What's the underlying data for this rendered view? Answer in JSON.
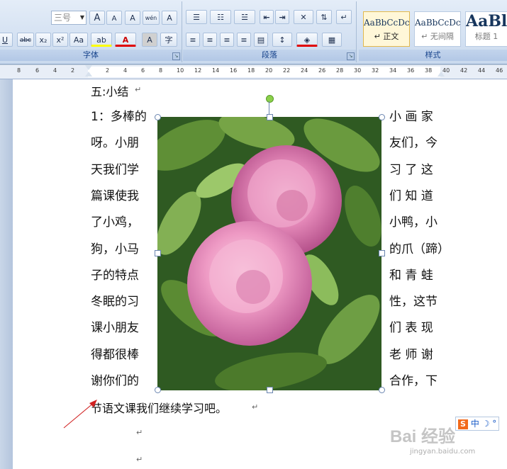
{
  "ribbon": {
    "font_group": {
      "label": "字体",
      "font_size_value": "三号",
      "btn_grow": "A",
      "btn_shrink": "A",
      "btn_clear": "A",
      "btn_phonetic": "wén",
      "btn_border_a": "A",
      "btn_underline": "U",
      "btn_strike": "abc",
      "btn_sub": "x₂",
      "btn_sup": "x²",
      "btn_case": "Aa",
      "btn_highlight": "ab",
      "btn_color": "A",
      "btn_shade_a": "A",
      "btn_enclose": "字"
    },
    "paragraph_group": {
      "label": "段落"
    },
    "styles_group": {
      "label": "样式",
      "styles": [
        {
          "sample": "AaBbCcDc",
          "name": "↵ 正文"
        },
        {
          "sample": "AaBbCcDc",
          "name": "↵ 无间隔"
        },
        {
          "sample": "AaBl",
          "name": "标题 1"
        }
      ]
    }
  },
  "ruler": {
    "left_numbers": [
      "8",
      "6",
      "4",
      "2"
    ],
    "right_numbers": [
      "2",
      "4",
      "6",
      "8",
      "10",
      "12",
      "14",
      "16",
      "18",
      "20",
      "22",
      "24",
      "26",
      "28",
      "30",
      "32",
      "34",
      "36",
      "38",
      "40",
      "42",
      "44",
      "46"
    ]
  },
  "document": {
    "heading": "五:小结",
    "left_lines": [
      "1：多棒的",
      "呀。小朋",
      "天我们学",
      "篇课使我",
      "了小鸡，",
      "狗，小马",
      "子的特点",
      "冬眠的习",
      "课小朋友",
      "得都很棒",
      "谢你们的"
    ],
    "right_lines": [
      "小 画 家",
      "友们，今",
      "习 了 这",
      "们 知 道",
      "小鸭，小",
      "的爪（蹄）",
      "和 青 蛙",
      "性，这节",
      "们 表 现",
      "老 师 谢",
      "合作，下"
    ],
    "last_line": "节语文课我们继续学习吧。",
    "paragraph_mark": "↵"
  },
  "image": {
    "alt": "pink peony flowers"
  },
  "watermark": {
    "text": "Bai 经验",
    "url": "jingyan.baidu.com"
  },
  "ime": {
    "text": "中"
  }
}
